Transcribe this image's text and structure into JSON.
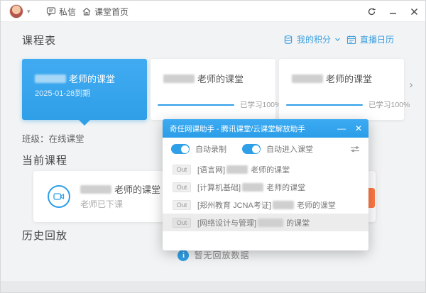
{
  "titlebar": {
    "messages_label": "私信",
    "home_label": "课堂首页"
  },
  "window_controls": {
    "refresh": "refresh",
    "minimize": "—",
    "close": "✕"
  },
  "header": {
    "title": "课程表",
    "points_label": "我的积分",
    "calendar_label": "直播日历"
  },
  "cards": [
    {
      "title_suffix": "老师的课堂",
      "expiry": "2025-01-28到期",
      "state": "active"
    },
    {
      "title_suffix": "老师的课堂",
      "progress_label": "已学习100%"
    },
    {
      "title_suffix": "老师的课堂",
      "progress_label": "已学习100%"
    }
  ],
  "class_info": "班级：在线课堂",
  "sections": {
    "current": "当前课程",
    "history": "历史回放"
  },
  "current_course": {
    "title_suffix": "老师的课堂",
    "status": "老师已下课"
  },
  "empty_state": {
    "text": "暂无回放数据"
  },
  "modal": {
    "title": "奇任网课助手 - 腾讯课堂/云课堂解放助手",
    "toggles": [
      {
        "label": "自动录制",
        "on": true
      },
      {
        "label": "自动进入课堂",
        "on": true
      }
    ],
    "rows": [
      {
        "tag": "Out",
        "prefix": "[语言网]",
        "suffix": "老师的课堂"
      },
      {
        "tag": "Out",
        "prefix": "[计算机基础]",
        "suffix": "老师的课堂"
      },
      {
        "tag": "Out",
        "prefix": "[郑州教育 JCNA考证]",
        "suffix": "老师的课堂"
      },
      {
        "tag": "Out",
        "prefix": "[网络设计与管理]",
        "suffix": "的课堂"
      }
    ]
  },
  "colors": {
    "accent_blue": "#2f9fe8",
    "card_active_blue": "#3aa6ee",
    "enter_button_orange": "#ff7a45",
    "highlight_row": "#ececec"
  }
}
